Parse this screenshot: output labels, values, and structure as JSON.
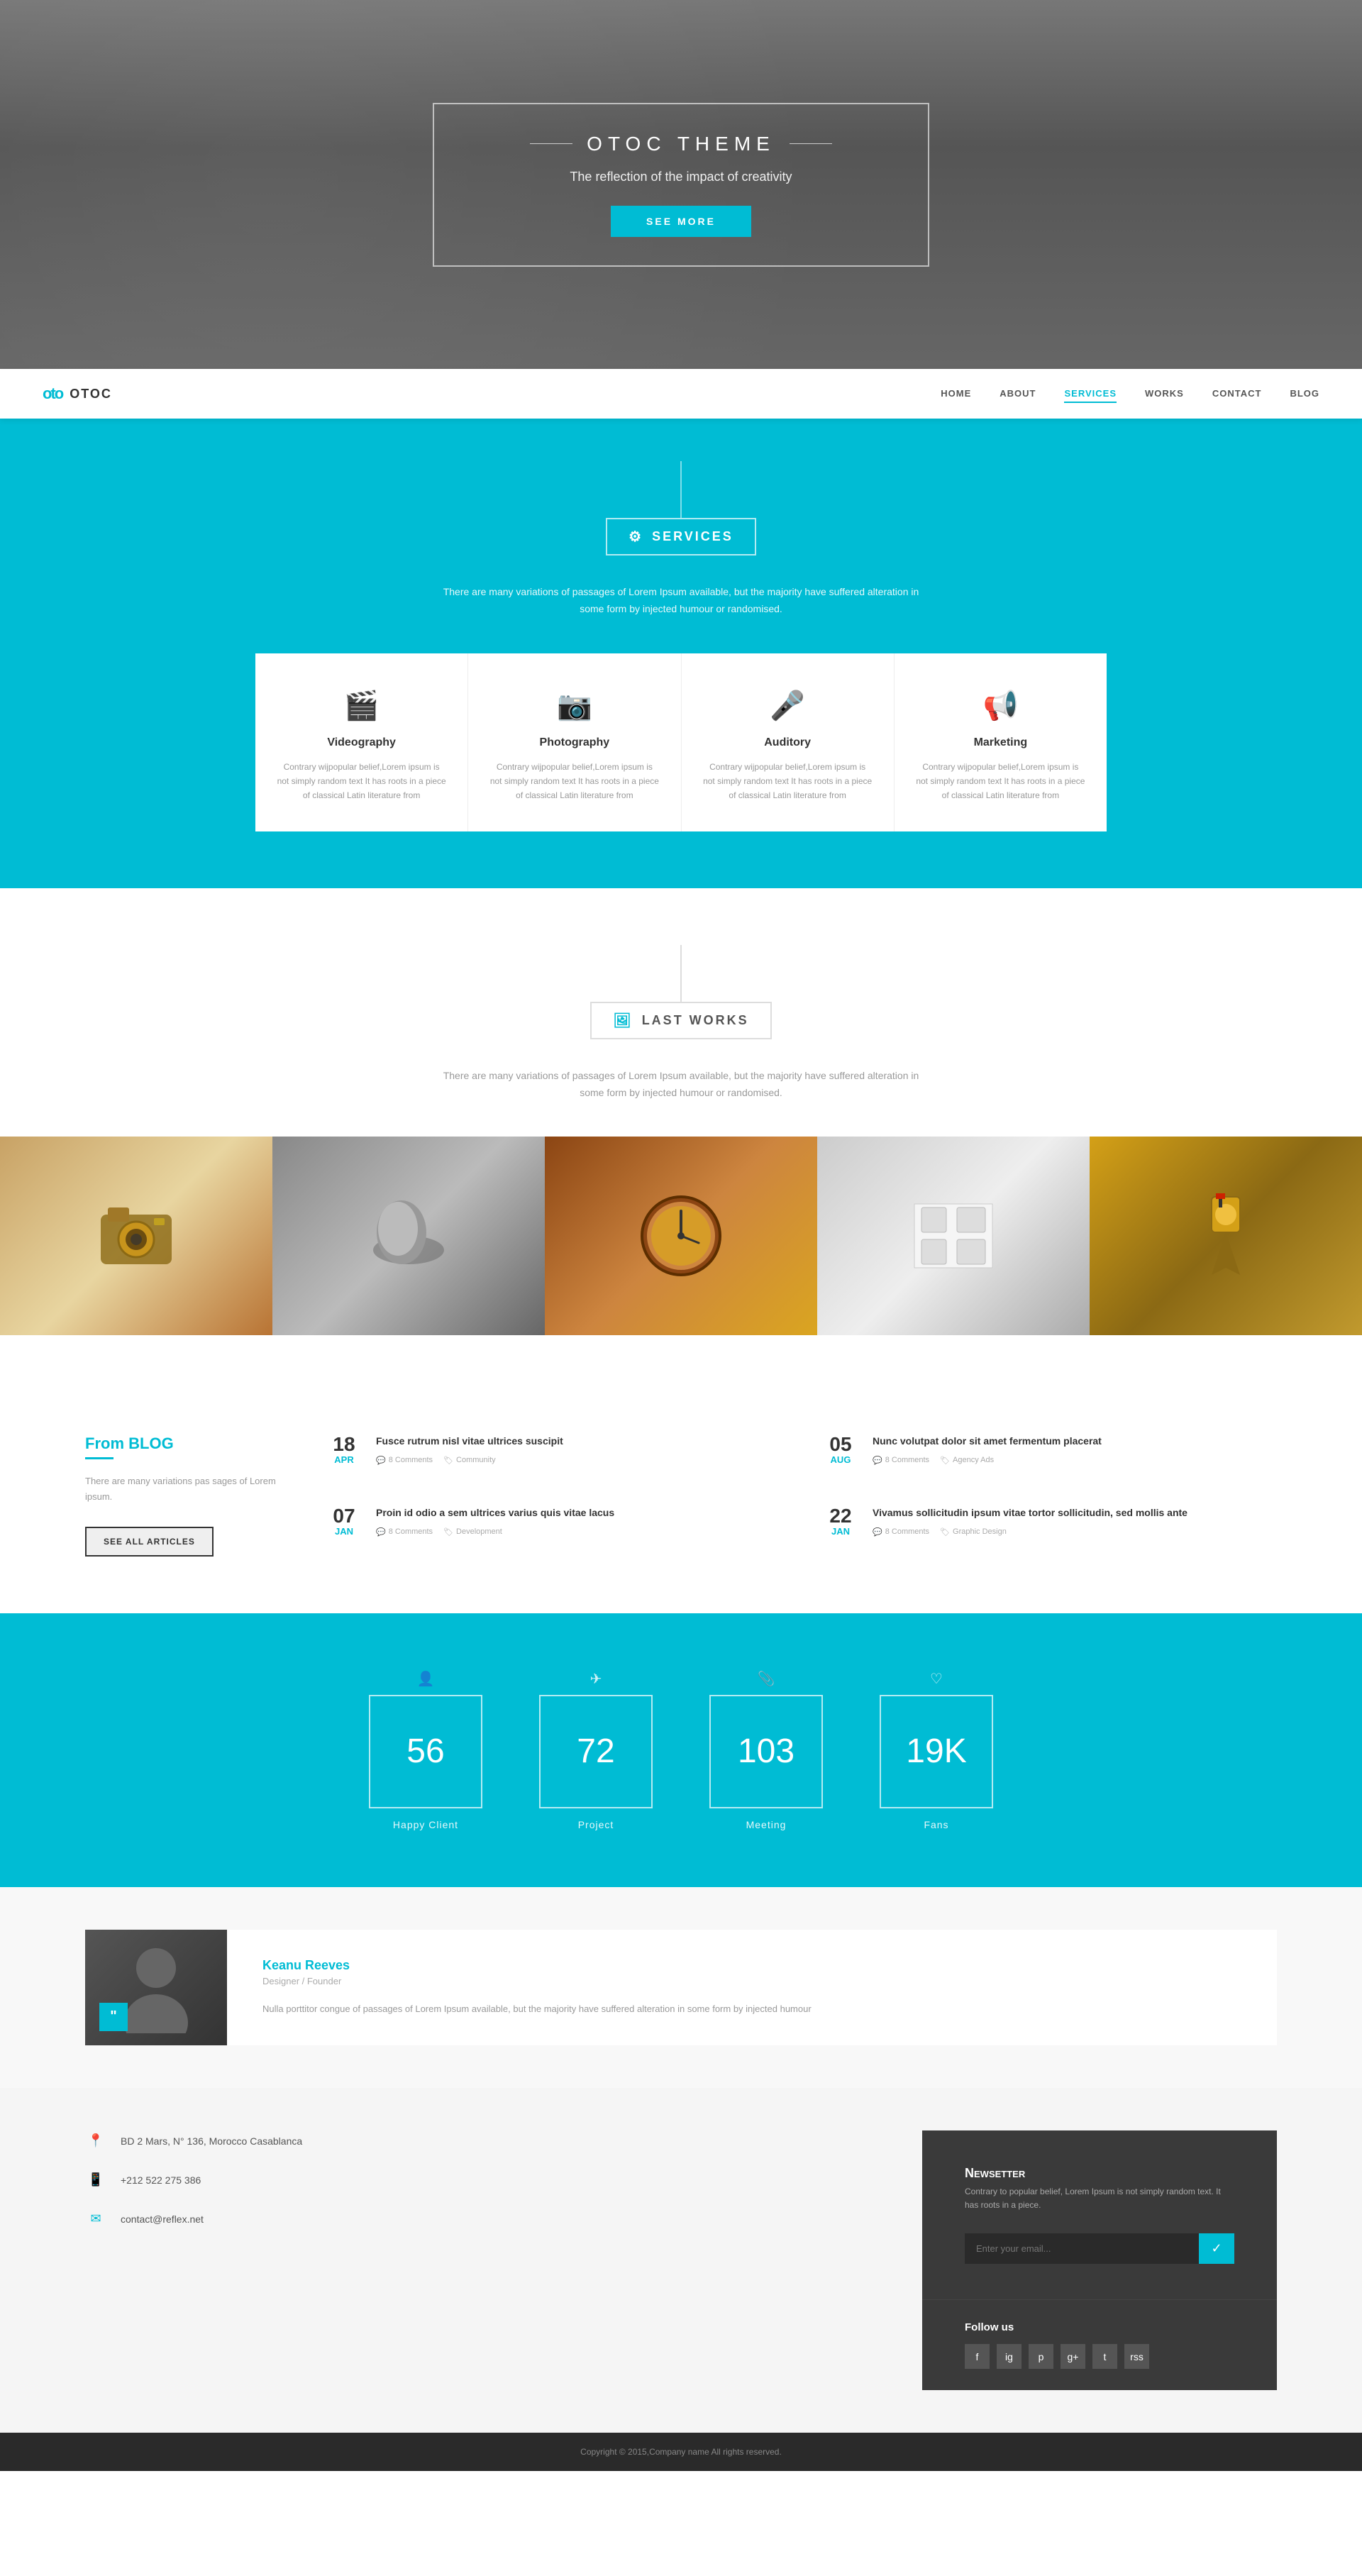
{
  "hero": {
    "theme": "OTOC THEME",
    "subtitle": "The reflection of the impact of creativity",
    "cta_label": "SEE MORE"
  },
  "nav": {
    "logo_icon": "oto",
    "logo_text": "OTOC",
    "links": [
      {
        "label": "HOME",
        "active": false
      },
      {
        "label": "ABOUT",
        "active": false
      },
      {
        "label": "SERVICES",
        "active": true
      },
      {
        "label": "WORKS",
        "active": false
      },
      {
        "label": "CONTACT",
        "active": false
      },
      {
        "label": "BLOG",
        "active": false
      }
    ]
  },
  "services": {
    "section_title": "SERVICES",
    "description": "There are many variations of passages of Lorem Ipsum available, but the majority have suffered alteration in some form by injected humour or randomised.",
    "cards": [
      {
        "icon": "🎬",
        "title": "Videography",
        "desc": "Contrary wijpopular belief,Lorem ipsum is not simply random text It has roots in a piece of classical Latin literature from"
      },
      {
        "icon": "📷",
        "title": "Photography",
        "desc": "Contrary wijpopular belief,Lorem ipsum is not simply random text It has roots in a piece of classical Latin literature from"
      },
      {
        "icon": "🎤",
        "title": "Auditory",
        "desc": "Contrary wijpopular belief,Lorem ipsum is not simply random text It has roots in a piece of classical Latin literature from"
      },
      {
        "icon": "📢",
        "title": "Marketing",
        "desc": "Contrary wijpopular belief,Lorem ipsum is not simply random text It has roots in a piece of classical Latin literature from"
      }
    ]
  },
  "works": {
    "section_title": "LAST WORKS",
    "description": "There are many variations of passages of Lorem Ipsum available, but the majority have suffered alteration in some form by injected humour or randomised.",
    "gallery": [
      {
        "label": "Vintage Camera",
        "color1": "#c8a265",
        "color2": "#8b6914"
      },
      {
        "label": "Abstract Shape",
        "color1": "#888",
        "color2": "#555"
      },
      {
        "label": "Clock",
        "color1": "#8b4513",
        "color2": "#daa520"
      },
      {
        "label": "Sketches",
        "color1": "#ccc",
        "color2": "#999"
      },
      {
        "label": "Warrior",
        "color1": "#d4a017",
        "color2": "#8b6914"
      }
    ]
  },
  "blog": {
    "label": "From",
    "title": "BLOG",
    "desc": "There are many variations pas sages of Lorem ipsum.",
    "see_all": "SEE ALL ARTICLES",
    "posts": [
      {
        "day": "18",
        "month": "APR",
        "title": "Fusce rutrum nisl vitae ultrices suscipit",
        "comments": "8 Comments",
        "category": "Community",
        "body": ""
      },
      {
        "day": "05",
        "month": "AUG",
        "title": "Nunc volutpat dolor sit amet fermentum placerat",
        "comments": "8 Comments",
        "category": "Agency Ads",
        "body": ""
      },
      {
        "day": "07",
        "month": "JAN",
        "title": "Proin id odio a sem ultrices varius quis vitae lacus",
        "comments": "8 Comments",
        "category": "Development",
        "body": ""
      },
      {
        "day": "22",
        "month": "JAN",
        "title": "Vivamus sollicitudin ipsum vitae tortor sollicitudin, sed mollis ante",
        "comments": "8 Comments",
        "category": "Graphic Design",
        "body": ""
      }
    ]
  },
  "stats": [
    {
      "number": "56",
      "label": "Happy Client",
      "icon": "👤"
    },
    {
      "number": "72",
      "label": "Project",
      "icon": "✈"
    },
    {
      "number": "103",
      "label": "Meeting",
      "icon": "📎"
    },
    {
      "number": "19K",
      "label": "Fans",
      "icon": "♡"
    }
  ],
  "testimonial": {
    "name": "Keanu Reeves",
    "role": "Designer / Founder",
    "text": "Nulla porttitor congue of passages of Lorem Ipsum available, but the majority have suffered alteration in some form by injected humour"
  },
  "footer": {
    "address": "BD 2 Mars, N° 136, Morocco Casablanca",
    "phone": "+212 522 275 386",
    "email": "contact@reflex.net",
    "newsletter_title": "Newsetter",
    "newsletter_desc": "Contrary to popular belief, Lorem Ipsum is not simply random text. It has roots in a piece.",
    "newsletter_placeholder": "",
    "follow_title": "Follow us",
    "social_icons": [
      "f",
      "ig",
      "p",
      "g+",
      "t",
      "rss"
    ],
    "copyright": "Copyright © 2015,Company name All rights reserved."
  }
}
